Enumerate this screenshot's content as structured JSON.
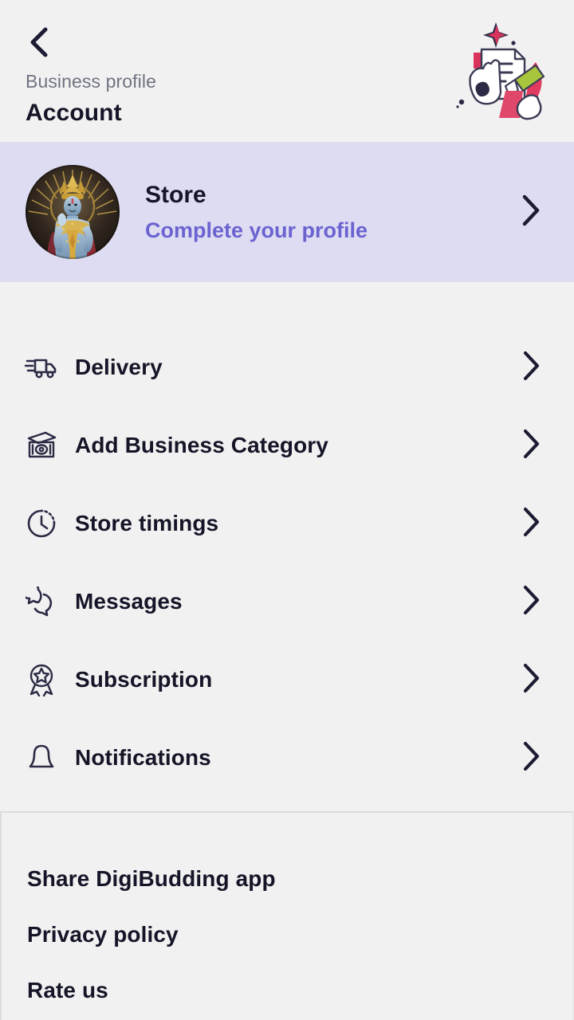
{
  "header": {
    "back_icon": "chevron-left-icon",
    "subtitle": "Business profile",
    "title": "Account",
    "artwork_icon": "document-signing-illustration"
  },
  "profile": {
    "avatar_icon": "deity-portrait-avatar",
    "name": "Store",
    "action_text": "Complete your profile",
    "chevron_icon": "chevron-right-icon"
  },
  "menu": {
    "items": [
      {
        "label": "Delivery",
        "icon": "delivery-truck-icon",
        "chevron": "chevron-right-icon"
      },
      {
        "label": "Add Business Category",
        "icon": "banknotes-icon",
        "chevron": "chevron-right-icon"
      },
      {
        "label": "Store timings",
        "icon": "clock-icon",
        "chevron": "chevron-right-icon"
      },
      {
        "label": "Messages",
        "icon": "chat-bubbles-icon",
        "chevron": "chevron-right-icon"
      },
      {
        "label": "Subscription",
        "icon": "award-badge-icon",
        "chevron": "chevron-right-icon"
      },
      {
        "label": "Notifications",
        "icon": "bell-icon",
        "chevron": "chevron-right-icon"
      }
    ]
  },
  "footer": {
    "items": [
      {
        "label": "Share DigiBudding app"
      },
      {
        "label": "Privacy policy"
      },
      {
        "label": "Rate us"
      }
    ]
  },
  "colors": {
    "page_background": "#F2F1F1",
    "profile_card_background": "#DEDCF2",
    "accent_purple": "#6B63D0",
    "text_primary": "#151528",
    "text_muted": "#6e7381"
  }
}
